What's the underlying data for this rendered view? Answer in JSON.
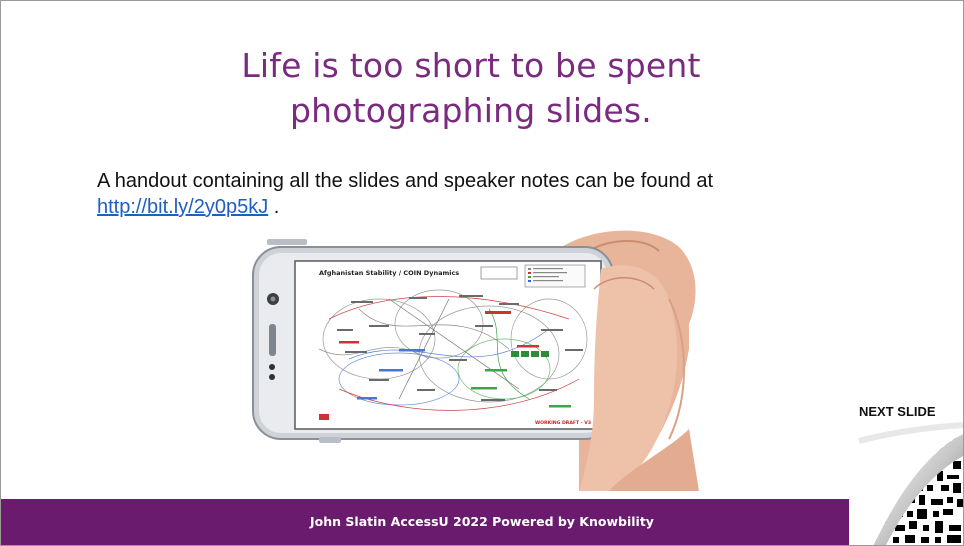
{
  "slide": {
    "title_line1": "Life is too short to be spent",
    "title_line2": "photographing slides.",
    "body_prefix": "A handout containing all the slides and speaker notes can be found at ",
    "link_text": "http://bit.ly/2y0p5kJ",
    "body_suffix": " .",
    "image": {
      "chart_title": "Afghanistan Stability / COIN Dynamics",
      "red_label": "WORKING DRAFT - V3",
      "icon": "hand-holding-phone-icon"
    },
    "next_slide_label": "NEXT SLIDE",
    "footer": "John Slatin AccessU 2022 Powered by Knowbility"
  },
  "colors": {
    "title": "#7a2a7f",
    "footer_bg": "#6a1b6e",
    "link": "#1f5fbf"
  }
}
